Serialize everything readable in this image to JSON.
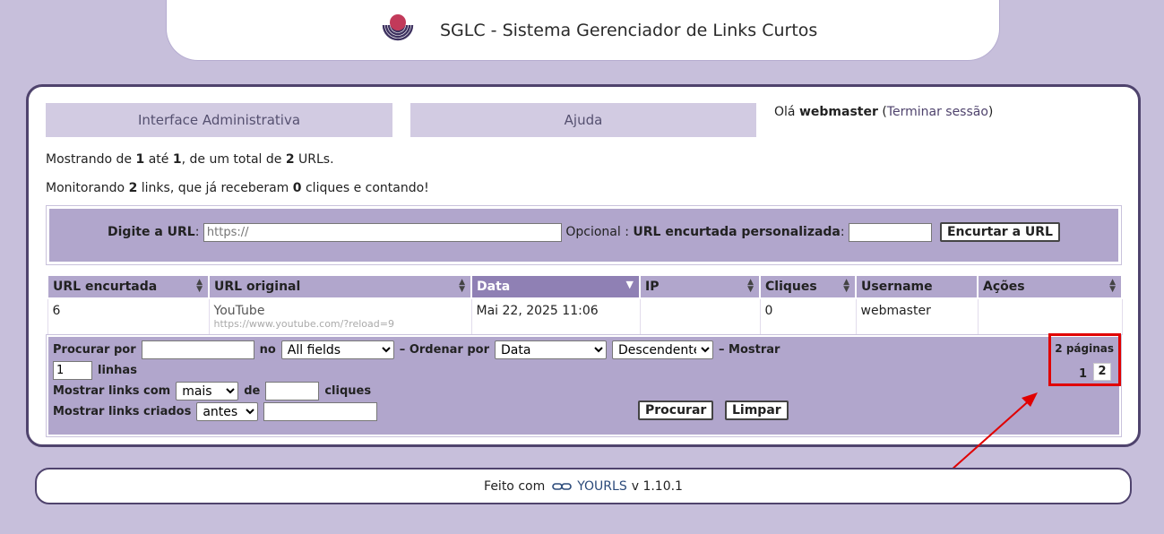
{
  "header": {
    "title": "SGLC - Sistema Gerenciador de Links Curtos",
    "logo_icon": "yourls-logo-icon",
    "logo_colors": {
      "ball": "#c23a5a",
      "arcs": "#3e3260"
    }
  },
  "nav": {
    "admin_label": "Interface Administrativa",
    "help_label": "Ajuda"
  },
  "greeting": {
    "hello": "Olá",
    "username": "webmaster",
    "logout_label": "Terminar sessão"
  },
  "info": {
    "showing_prefix": "Mostrando de",
    "showing_from": "1",
    "showing_to_word": "até",
    "showing_to": "1",
    "showing_total_word": ", de um total de",
    "showing_total": "2",
    "showing_suffix": "URLs.",
    "monitoring_prefix": "Monitorando",
    "monitoring_links": "2",
    "monitoring_mid": "links, que já receberam",
    "monitoring_clicks": "0",
    "monitoring_suffix": "cliques e contando!"
  },
  "new_url": {
    "url_label": "Digite a URL",
    "url_placeholder": "https://",
    "optional_label": "Opcional",
    "custom_label": "URL encurtada personalizada",
    "custom_value": "",
    "submit_label": "Encurtar a URL"
  },
  "table": {
    "headers": [
      "URL encurtada",
      "URL original",
      "Data",
      "IP",
      "Cliques",
      "Username",
      "Ações"
    ],
    "sorted_column": "Data",
    "rows": [
      {
        "short": "6",
        "title": "YouTube",
        "url": "https://www.youtube.com/?reload=9",
        "date": "Mai 22, 2025 11:06",
        "ip": "",
        "clicks": "0",
        "username": "webmaster",
        "actions": ""
      }
    ]
  },
  "filters": {
    "search_label": "Procurar por",
    "search_value": "",
    "in_label": "no",
    "field_selected": "All fields",
    "order_label": "– Ordenar por",
    "order_selected": "Data",
    "direction_selected": "Descendente",
    "show_label": "– Mostrar",
    "per_page_value": "1",
    "lines_label": "linhas",
    "clicks_label": "Mostrar links com",
    "clicks_op_selected": "mais",
    "clicks_of_label": "de",
    "clicks_value": "",
    "clicks_suffix": "cliques",
    "created_label": "Mostrar links criados",
    "created_op_selected": "antes",
    "created_value": "",
    "search_button": "Procurar",
    "clear_button": "Limpar"
  },
  "pagination": {
    "pages_label": "2 páginas",
    "page_1": "1",
    "page_2": "2",
    "current_page": 2
  },
  "annotation": {
    "highlight_color": "#e00000"
  },
  "footer": {
    "made_with": "Feito com",
    "link_icon": "chain-link-icon",
    "link_label": "YOURLS",
    "version": "v 1.10.1"
  }
}
